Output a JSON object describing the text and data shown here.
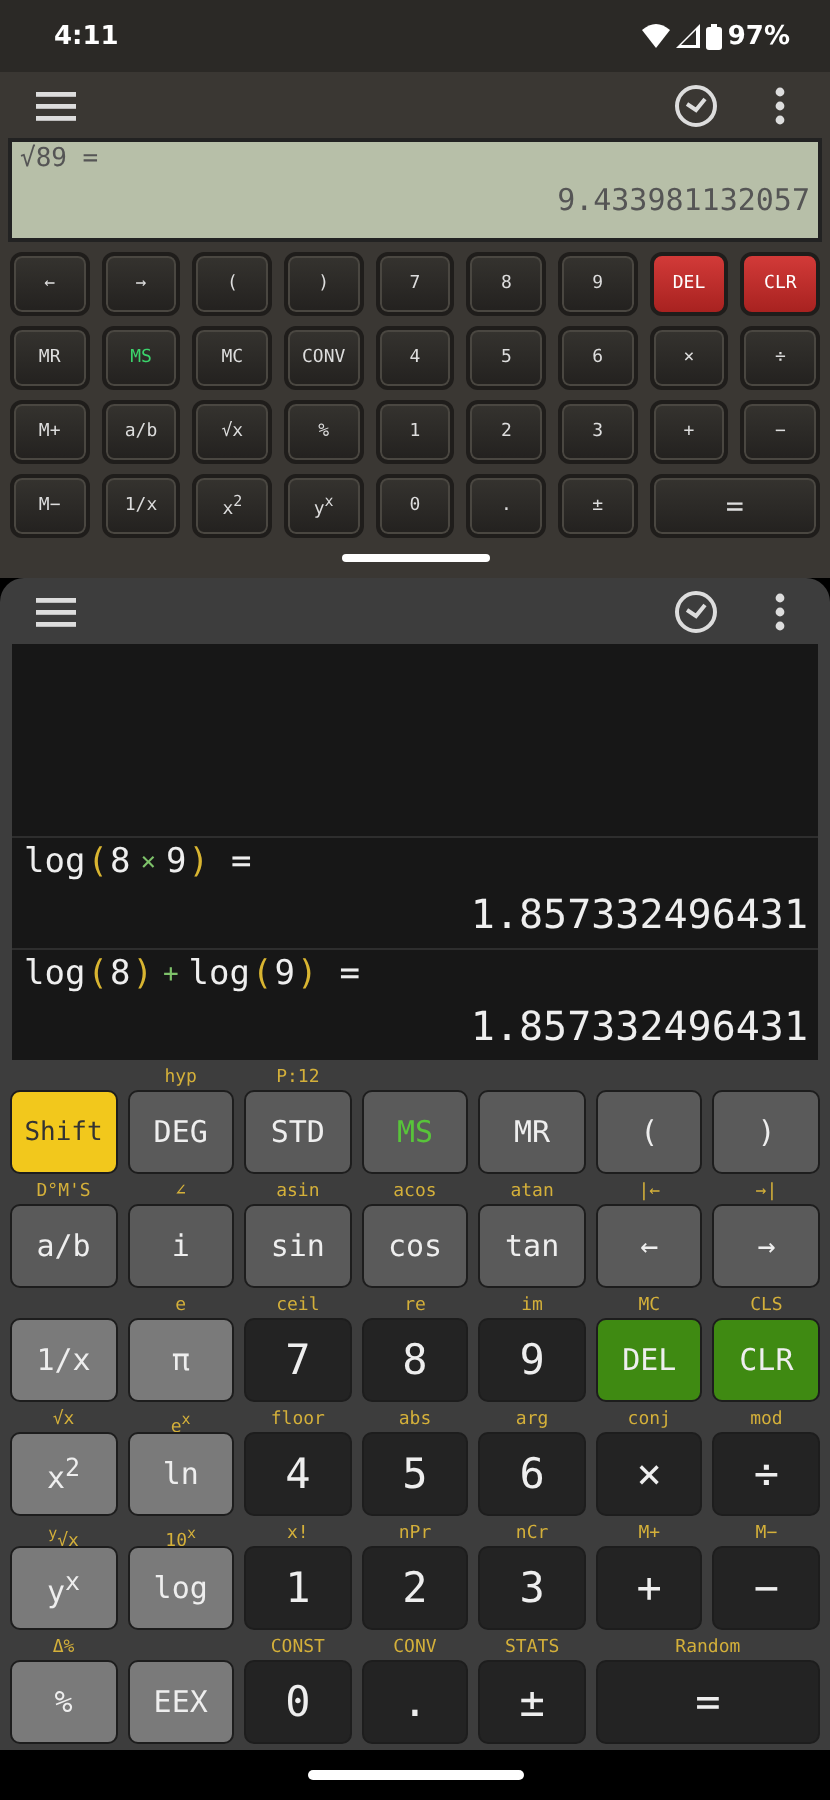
{
  "status_bar": {
    "time": "4:11",
    "battery": "97%"
  },
  "top_calculator": {
    "display": {
      "expression": "√89 =",
      "result": "9.433981132057"
    },
    "keys": [
      {
        "label": "←",
        "kind": "dark"
      },
      {
        "label": "→",
        "kind": "dark"
      },
      {
        "label": "(",
        "kind": "dark"
      },
      {
        "label": ")",
        "kind": "dark"
      },
      {
        "label": "7",
        "kind": "dark"
      },
      {
        "label": "8",
        "kind": "dark"
      },
      {
        "label": "9",
        "kind": "dark"
      },
      {
        "label": "DEL",
        "kind": "red"
      },
      {
        "label": "CLR",
        "kind": "red"
      },
      {
        "label": "MR",
        "kind": "dark"
      },
      {
        "label": "MS",
        "kind": "ms"
      },
      {
        "label": "MC",
        "kind": "dark"
      },
      {
        "label": "CONV",
        "kind": "dark"
      },
      {
        "label": "4",
        "kind": "dark"
      },
      {
        "label": "5",
        "kind": "dark"
      },
      {
        "label": "6",
        "kind": "dark"
      },
      {
        "label": "×",
        "kind": "dark"
      },
      {
        "label": "÷",
        "kind": "dark"
      },
      {
        "label": "M+",
        "kind": "dark"
      },
      {
        "label": "a/b",
        "kind": "dark"
      },
      {
        "label": "√x",
        "kind": "dark"
      },
      {
        "label": "%",
        "kind": "dark"
      },
      {
        "label": "1",
        "kind": "dark"
      },
      {
        "label": "2",
        "kind": "dark"
      },
      {
        "label": "3",
        "kind": "dark"
      },
      {
        "label": "+",
        "kind": "dark"
      },
      {
        "label": "−",
        "kind": "dark"
      },
      {
        "label": "M−",
        "kind": "dark"
      },
      {
        "label": "1/x",
        "kind": "dark"
      },
      {
        "label": "x$^{2}$",
        "kind": "dark"
      },
      {
        "label": "y$^{x}$",
        "kind": "dark"
      },
      {
        "label": "0",
        "kind": "dark"
      },
      {
        "label": ".",
        "kind": "dark"
      },
      {
        "label": "±",
        "kind": "dark"
      },
      {
        "label": "=",
        "kind": "dark",
        "wide": true
      }
    ]
  },
  "bottom_calculator": {
    "history": [
      {
        "expression": [
          {
            "text": "log",
            "kind": "fn"
          },
          {
            "text": "(",
            "kind": "paren"
          },
          {
            "text": "8",
            "kind": "num"
          },
          {
            "text": "×",
            "kind": "op"
          },
          {
            "text": "9",
            "kind": "num"
          },
          {
            "text": ")",
            "kind": "paren"
          },
          {
            "text": "=",
            "kind": "eq"
          }
        ],
        "result": "1.857332496431"
      },
      {
        "expression": [
          {
            "text": "log",
            "kind": "fn"
          },
          {
            "text": "(",
            "kind": "paren"
          },
          {
            "text": "8",
            "kind": "num"
          },
          {
            "text": ")",
            "kind": "paren"
          },
          {
            "text": "+",
            "kind": "op"
          },
          {
            "text": "log",
            "kind": "fn"
          },
          {
            "text": "(",
            "kind": "paren"
          },
          {
            "text": "9",
            "kind": "num"
          },
          {
            "text": ")",
            "kind": "paren"
          },
          {
            "text": "=",
            "kind": "eq"
          }
        ],
        "result": "1.857332496431"
      }
    ],
    "keys": [
      {
        "label": "Shift",
        "kind": "shift"
      },
      {
        "label": "DEG",
        "kind": "fn",
        "shift_label": "hyp"
      },
      {
        "label": "STD",
        "kind": "fn",
        "shift_label": "P:12"
      },
      {
        "label": "MS",
        "kind": "ms"
      },
      {
        "label": "MR",
        "kind": "fn"
      },
      {
        "label": "(",
        "kind": "fn"
      },
      {
        "label": ")",
        "kind": "fn"
      },
      {
        "label": "a/b",
        "kind": "fn",
        "shift_label": "D°M'S"
      },
      {
        "label": "i",
        "kind": "fn",
        "shift_label": "∠"
      },
      {
        "label": "sin",
        "kind": "fn",
        "shift_label": "asin"
      },
      {
        "label": "cos",
        "kind": "fn",
        "shift_label": "acos"
      },
      {
        "label": "tan",
        "kind": "fn",
        "shift_label": "atan"
      },
      {
        "label": "←",
        "kind": "fn",
        "shift_label": "|←"
      },
      {
        "label": "→",
        "kind": "fn",
        "shift_label": "→|"
      },
      {
        "label": "1/x",
        "kind": "sci"
      },
      {
        "label": "π",
        "kind": "sci",
        "shift_label": "e"
      },
      {
        "label": "7",
        "kind": "num",
        "shift_label": "ceil"
      },
      {
        "label": "8",
        "kind": "num",
        "shift_label": "re"
      },
      {
        "label": "9",
        "kind": "num",
        "shift_label": "im"
      },
      {
        "label": "DEL",
        "kind": "green",
        "shift_label": "MC"
      },
      {
        "label": "CLR",
        "kind": "green",
        "shift_label": "CLS"
      },
      {
        "label": "x$^{2}$",
        "kind": "sci",
        "shift_label": "√x"
      },
      {
        "label": "ln",
        "kind": "sci",
        "shift_label": "e$^{x}$"
      },
      {
        "label": "4",
        "kind": "num",
        "shift_label": "floor"
      },
      {
        "label": "5",
        "kind": "num",
        "shift_label": "abs"
      },
      {
        "label": "6",
        "kind": "num",
        "shift_label": "arg"
      },
      {
        "label": "×",
        "kind": "num",
        "shift_label": "conj"
      },
      {
        "label": "÷",
        "kind": "num",
        "shift_label": "mod"
      },
      {
        "label": "y$^{x}$",
        "kind": "sci",
        "shift_label": "$^{y}$√x"
      },
      {
        "label": "log",
        "kind": "sci",
        "shift_label": "10$^{x}$"
      },
      {
        "label": "1",
        "kind": "num",
        "shift_label": "x!"
      },
      {
        "label": "2",
        "kind": "num",
        "shift_label": "nPr"
      },
      {
        "label": "3",
        "kind": "num",
        "shift_label": "nCr"
      },
      {
        "label": "+",
        "kind": "num",
        "shift_label": "M+"
      },
      {
        "label": "−",
        "kind": "num",
        "shift_label": "M−"
      },
      {
        "label": "%",
        "kind": "sci",
        "shift_label": "Δ%"
      },
      {
        "label": "EEX",
        "kind": "sci"
      },
      {
        "label": "0",
        "kind": "num",
        "shift_label": "CONST"
      },
      {
        "label": ".",
        "kind": "num",
        "shift_label": "CONV"
      },
      {
        "label": "±",
        "kind": "num",
        "shift_label": "STATS"
      },
      {
        "label": "=",
        "kind": "num",
        "shift_label": "Random",
        "wide": true
      }
    ]
  }
}
